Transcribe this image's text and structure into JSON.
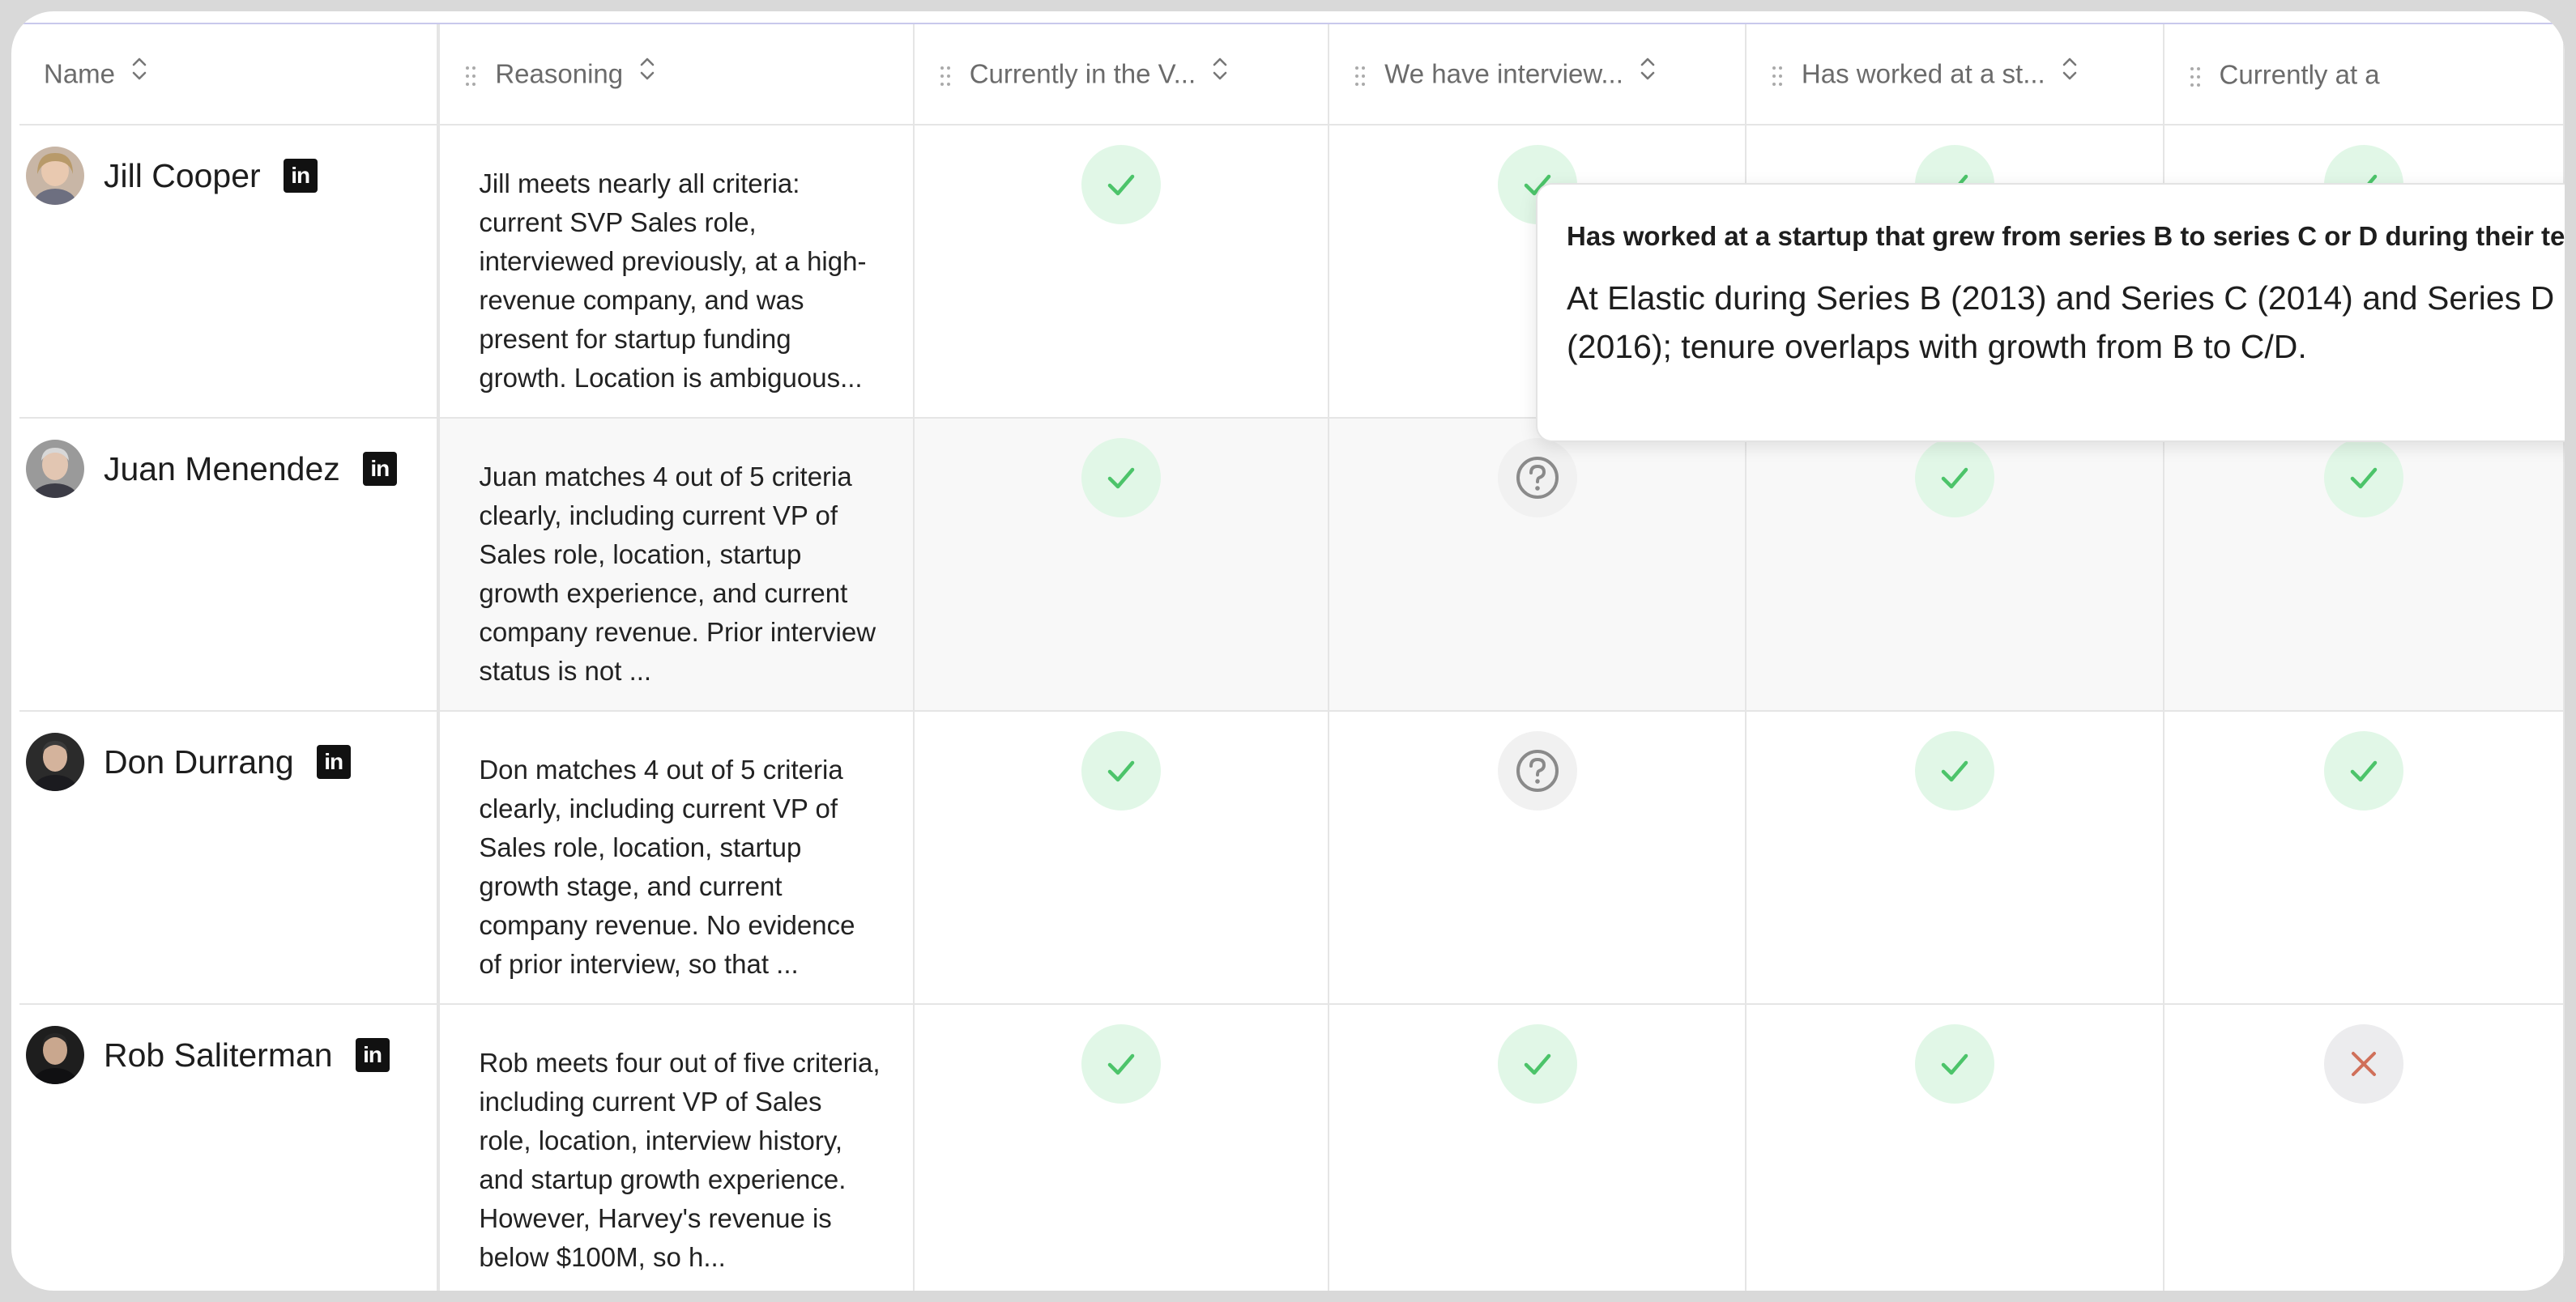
{
  "columns": [
    {
      "label": "Name"
    },
    {
      "label": "Reasoning"
    },
    {
      "label": "Currently in the V..."
    },
    {
      "label": "We have interview..."
    },
    {
      "label": "Has worked at a st..."
    },
    {
      "label": "Currently at a "
    }
  ],
  "rows": [
    {
      "name": "Jill Cooper",
      "reasoning": "Jill meets nearly all criteria: current SVP Sales role, interviewed previously, at a high-revenue company, and was present for startup funding growth. Location is ambiguous...",
      "statuses": [
        "yes",
        "yes",
        "yes",
        "yes"
      ]
    },
    {
      "name": "Juan Menendez",
      "reasoning": "Juan matches 4 out of 5 criteria clearly, including current VP of Sales role, location, startup growth experience, and current company revenue. Prior interview status is not ...",
      "statuses": [
        "yes",
        "unknown",
        "yes",
        "yes"
      ]
    },
    {
      "name": "Don Durrang",
      "reasoning": "Don matches 4 out of 5 criteria clearly, including current VP of Sales role, location, startup growth stage, and current company revenue. No evidence of prior interview, so that ...",
      "statuses": [
        "yes",
        "unknown",
        "yes",
        "yes"
      ]
    },
    {
      "name": "Rob Saliterman",
      "reasoning": "Rob meets four out of five criteria, including current VP of Sales role, location, interview history, and startup growth experience. However, Harvey's revenue is below $100M, so h...",
      "statuses": [
        "yes",
        "yes",
        "yes",
        "no"
      ]
    }
  ],
  "tooltip": {
    "title": "Has worked at a startup that grew from series B to series C or D during their tenure",
    "body": "At Elastic during Series B (2013) and Series C (2014) and Series D (2016); tenure overlaps with growth from B to C/D."
  },
  "colors": {
    "check": "#4cc46a",
    "check_bg": "#e1f7e7",
    "unknown": "#8a8a8a",
    "cross": "#d0705a"
  }
}
